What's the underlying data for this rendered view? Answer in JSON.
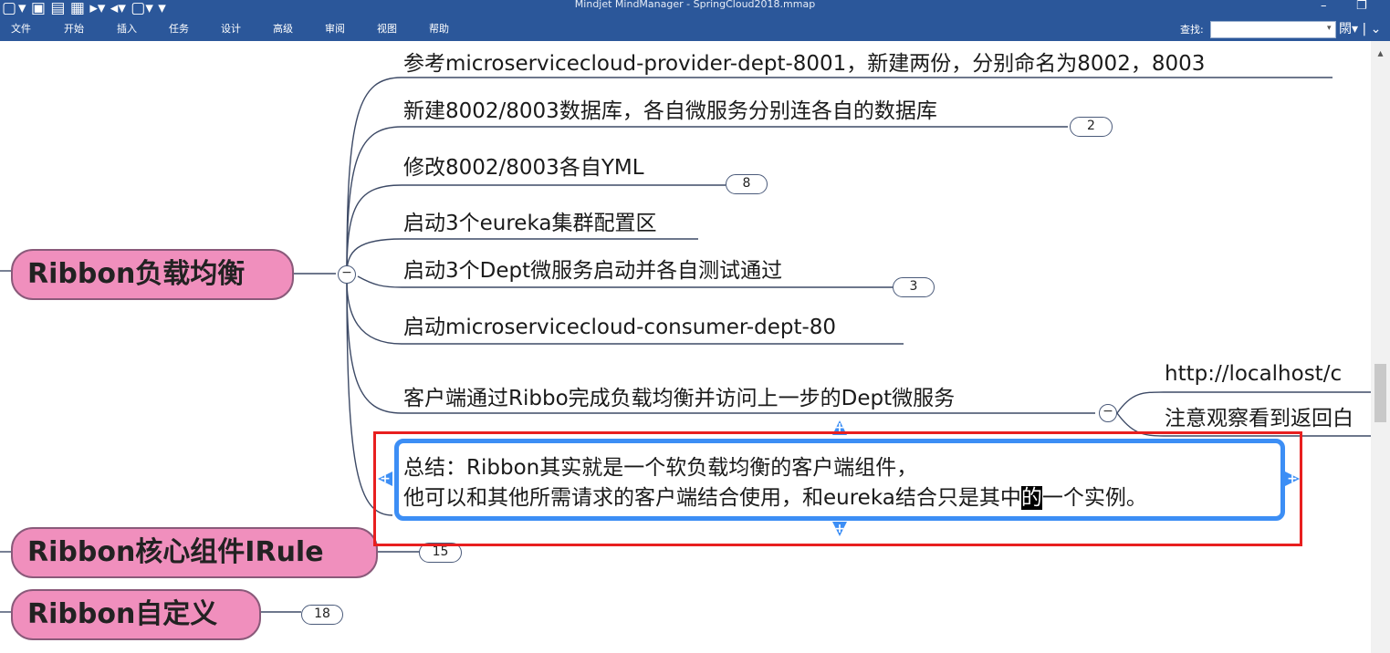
{
  "titlebar": {
    "app_title": "Mindjet MindManager - SpringCloud2018.mmap",
    "minimize": "–",
    "restore": "❐"
  },
  "menu": [
    "文件",
    "开始",
    "插入",
    "任务",
    "设计",
    "高级",
    "审阅",
    "视图",
    "帮助"
  ],
  "find": {
    "label": "查找:",
    "value": ""
  },
  "mindmap": {
    "main_topics": [
      {
        "label": "Ribbon负载均衡"
      },
      {
        "label": "Ribbon核心组件IRule",
        "badge": "15"
      },
      {
        "label": "Ribbon自定义",
        "badge": "18"
      }
    ],
    "subtopics": [
      {
        "label": "参考microservicecloud-provider-dept-8001，新建两份，分别命名为8002，8003"
      },
      {
        "label": "新建8002/8003数据库，各自微服务分别连各自的数据库",
        "badge": "2"
      },
      {
        "label": "修改8002/8003各自YML",
        "badge": "8"
      },
      {
        "label": "启动3个eureka集群配置区"
      },
      {
        "label": "启动3个Dept微服务启动并各自测试通过",
        "badge": "3"
      },
      {
        "label": "启动microservicecloud-consumer-dept-80"
      },
      {
        "label": "客户端通过Ribbo完成负载均衡并访问上一步的Dept微服务"
      }
    ],
    "right_children": [
      {
        "label": "http://localhost/c"
      },
      {
        "label": "注意观察看到返回白"
      }
    ],
    "summary": {
      "line1": "总结：Ribbon其实就是一个软负载均衡的客户端组件，",
      "line2_before": "他可以和其他所需请求的客户端结合使用，和eureka结合只是其中",
      "line2_selected": "的",
      "line2_after": "一个实例。"
    },
    "toggle_symbol": "−"
  },
  "colors": {
    "ribbon": "#2b579a",
    "main_topic_fill": "#f08fbd",
    "selection": "#3c8ef5",
    "highlight_box": "#e81f1f"
  }
}
